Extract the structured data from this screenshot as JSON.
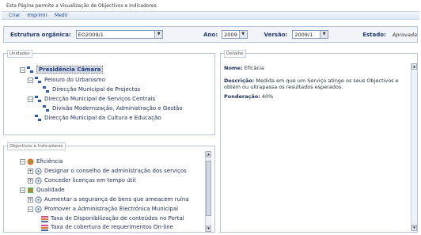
{
  "page": {
    "description": "Esta Página permite a Visualização de Objectivos e Indicadores."
  },
  "menu": [
    {
      "label": "Criar"
    },
    {
      "label": "Imprimir"
    },
    {
      "label": "Medir"
    }
  ],
  "filters": {
    "estrutura_label": "Estrutura orgânica:",
    "estrutura_value": "EO2009/1",
    "ano_label": "Ano:",
    "ano_value": "2009",
    "versao_label": "Versão:",
    "versao_value": "2009/1",
    "estado_label": "Estado:",
    "estado_value": "Aprovada"
  },
  "unidades": {
    "title": "Unidades",
    "nodes": [
      {
        "label": "Presidência Câmara"
      },
      {
        "label": "Pelouro do Urbanismo"
      },
      {
        "label": "Direcção Municipal de Projectos"
      },
      {
        "label": "Direcção Municipal de Serviços Centrais"
      },
      {
        "label": "Divisão Modernização, Administração e Gestão"
      },
      {
        "label": "Direcção Municipal da Cultura e Educação"
      }
    ]
  },
  "objectivos": {
    "title": "Objectivos e Indicadores",
    "nodes": [
      {
        "label": "Eficiência"
      },
      {
        "label": "Designar o conselho de administração dos serviços"
      },
      {
        "label": "Conceder licenças em tempo útil"
      },
      {
        "label": "Qualidade"
      },
      {
        "label": "Aumentar a segurança de bens que ameacem ruína"
      },
      {
        "label": "Promover a Administração Electrónica Municipal"
      },
      {
        "label": "Taxa de Disponibilização de conteúdos no Portal"
      },
      {
        "label": "Taxa de cobertura de requerimentos On-line"
      }
    ]
  },
  "detalhe": {
    "title": "Detalhe",
    "nome_label": "Nome:",
    "nome_value": "Eficácia",
    "descricao_label": "Descrição:",
    "descricao_value": "Medida em que um Serviço atinge os seus Objectivos e obtém ou ultrapassa os resultados esperados.",
    "ponderacao_label": "Ponderação:",
    "ponderacao_value": "40%"
  },
  "colors": {
    "accent": "#1b3f8f",
    "panel_border": "#b8c4d8",
    "org_icon": "#3a6fd6",
    "eficiencia_icon": "#e0702a",
    "indicator_icon": "#d84b8b"
  }
}
